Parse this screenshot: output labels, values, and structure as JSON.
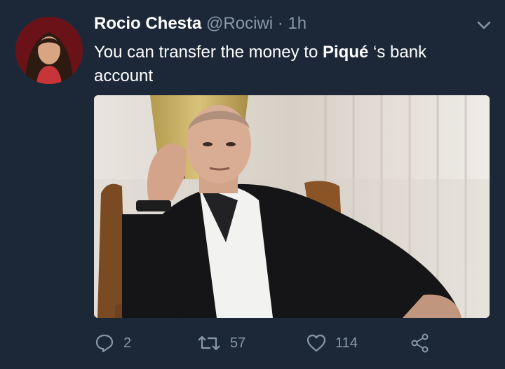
{
  "tweet": {
    "author_name": "Rocio Chesta",
    "handle": "@Rociwi",
    "separator": "·",
    "time": "1h",
    "text_before": "You can transfer the money to ",
    "text_bold": "Piqué",
    "text_after": " ‘s bank account"
  },
  "actions": {
    "reply_count": "2",
    "retweet_count": "57",
    "like_count": "114"
  },
  "icons": {
    "caret": "chevron-down-icon",
    "reply": "reply-icon",
    "retweet": "retweet-icon",
    "like": "heart-icon",
    "share": "share-icon"
  },
  "colors": {
    "background": "#1c2838",
    "secondary_text": "#8899a6",
    "primary_text": "#ffffff"
  }
}
